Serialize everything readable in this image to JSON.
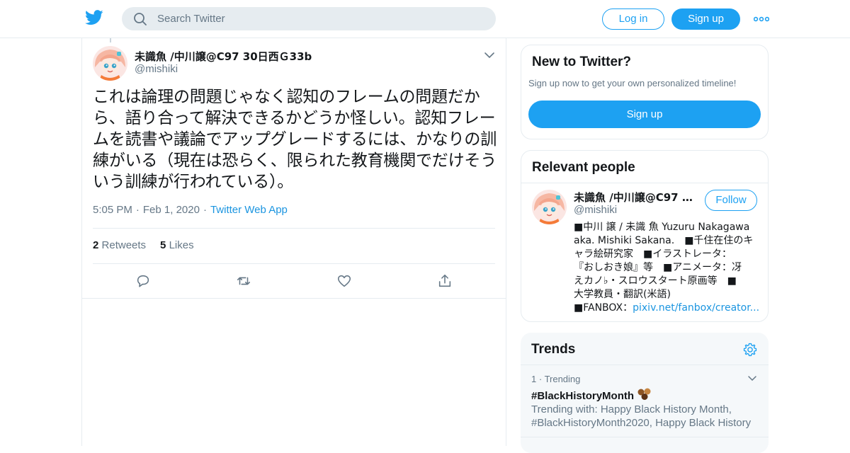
{
  "colors": {
    "accent": "#1da1f2",
    "link": "#1b95e0",
    "muted": "#657786",
    "border": "#e6ecf0"
  },
  "header": {
    "logo": "twitter-bird-icon",
    "search_placeholder": "Search Twitter",
    "login_label": "Log in",
    "signup_label": "Sign up",
    "more": "more-dots-icon"
  },
  "tweet": {
    "author_name": "未識魚 /中川譲@C97 30日西Ｇ33b",
    "handle": "@mishiki",
    "text": "これは論理の問題じゃなく認知のフレームの問題だから、語り合って解決できるかどうか怪しい。認知フレームを読書や議論でアップグレードするには、かなりの訓練がいる（現在は恐らく、限られた教育機関でだけそういう訓練が行われている）。",
    "time": "5:05 PM",
    "date": "Feb 1, 2020",
    "source": "Twitter Web App",
    "retweets_count": "2",
    "retweets_label": "Retweets",
    "likes_count": "5",
    "likes_label": "Likes"
  },
  "sidebar": {
    "new_to_twitter": {
      "title": "New to Twitter?",
      "subtitle": "Sign up now to get your own personalized timeline!",
      "signup_label": "Sign up"
    },
    "relevant_people": {
      "title": "Relevant people",
      "name": "未識魚 /中川譲@C97 30...",
      "handle": "@mishiki",
      "follow_label": "Follow",
      "bio_lines": [
        "■中川 譲 / 未識 魚 Yuzuru Nakagawa",
        "aka. Mishiki Sakana.　■千住在住のキ",
        "ャラ絵研究家　■イラストレータ：",
        "『おしおき娘』等　■アニメータ：冴",
        "えカノ♭・スロウスタート原画等　■",
        "大学教員・翻訳(米語)"
      ],
      "bio_fanbox_prefix": "■FANBOX：",
      "bio_link": "pixiv.net/fanbox/creator..."
    },
    "trends": {
      "title": "Trends",
      "items": [
        {
          "rank": "1",
          "label": "Trending",
          "tag": "#BlackHistoryMonth",
          "with_text": "Trending with: Happy Black History Month, #BlackHistoryMonth2020, Happy Black History"
        }
      ]
    }
  }
}
